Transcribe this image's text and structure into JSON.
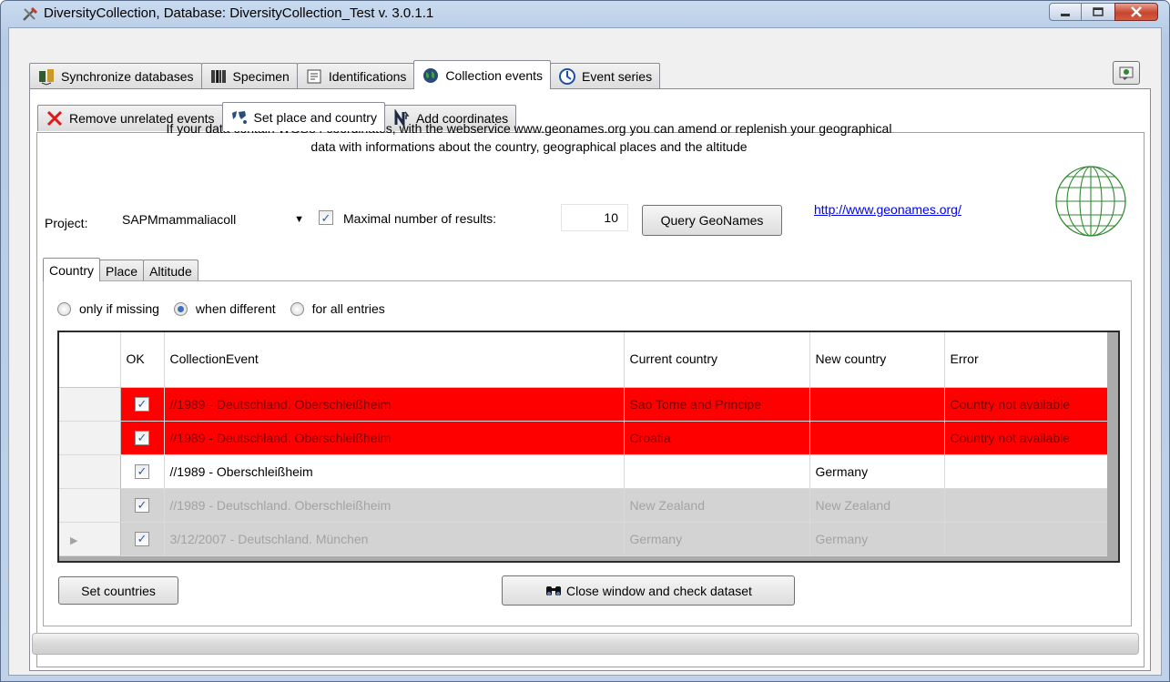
{
  "window": {
    "title": "DiversityCollection,  Database: DiversityCollection_Test   v. 3.0.1.1",
    "minimize_icon": "minimize-icon",
    "restore_icon": "restore-icon",
    "close_icon": "close-icon"
  },
  "main_tabs": [
    {
      "label": "Synchronize databases",
      "icon": "sync-icon"
    },
    {
      "label": "Specimen",
      "icon": "barcode-icon"
    },
    {
      "label": "Identifications",
      "icon": "identification-icon"
    },
    {
      "label": "Collection events",
      "icon": "globe-icon",
      "active": true
    },
    {
      "label": "Event series",
      "icon": "event-series-icon"
    }
  ],
  "sub_tabs": [
    {
      "label": "Remove unrelated events",
      "icon": "red-x-icon"
    },
    {
      "label": "Set place and country",
      "icon": "place-icon",
      "active": true
    },
    {
      "label": "Add coordinates",
      "icon": "coordinates-icon"
    }
  ],
  "description": {
    "line1": "If your data contain WGS84 coordinates, with the webservice www.geonames.org you can amend or replenish your geographical",
    "line2": "data with informations about the country,  geographical places and the altitude"
  },
  "query": {
    "project_label": "Project:",
    "project_value": "SAPMmammaliacoll",
    "max_checked": true,
    "max_label": "Maximal number of results:",
    "max_value": "10",
    "query_button": "Query GeoNames",
    "link": "http://www.geonames.org/"
  },
  "inner_tabs": [
    {
      "label": "Country",
      "active": true
    },
    {
      "label": "Place"
    },
    {
      "label": "Altitude"
    }
  ],
  "mode_options": [
    {
      "label": "only if missing",
      "selected": false
    },
    {
      "label": "when different",
      "selected": true
    },
    {
      "label": "for all entries",
      "selected": false
    }
  ],
  "grid": {
    "columns": {
      "ok": "OK",
      "event": "CollectionEvent",
      "current": "Current country",
      "new": "New country",
      "error": "Error"
    },
    "rows": [
      {
        "state": "err",
        "ok": true,
        "event": "//1989 - Deutschland. Oberschleißheim",
        "current": "Sao Tome and Principe",
        "new": "",
        "error": "Country not available",
        "current_row": false
      },
      {
        "state": "err",
        "ok": true,
        "event": "//1989 - Deutschland. Oberschleißheim",
        "current": "Croatia",
        "new": "",
        "error": "Country not available",
        "current_row": false
      },
      {
        "state": "ok",
        "ok": true,
        "event": "//1989 - Oberschleißheim",
        "current": "",
        "new": "Germany",
        "error": "",
        "current_row": false
      },
      {
        "state": "ro",
        "ok": true,
        "event": "//1989 - Deutschland. Oberschleißheim",
        "current": "New Zealand",
        "new": "New Zealand",
        "error": "",
        "current_row": false
      },
      {
        "state": "ro",
        "ok": true,
        "event": "3/12/2007 - Deutschland. München",
        "current": "Germany",
        "new": "Germany",
        "error": "",
        "current_row": true
      }
    ]
  },
  "buttons": {
    "set_countries": "Set countries",
    "close_check": "Close window and check dataset"
  },
  "colors": {
    "error_row": "#ff0000",
    "readonly_row": "#d3d3d3",
    "link": "#0000ee"
  }
}
